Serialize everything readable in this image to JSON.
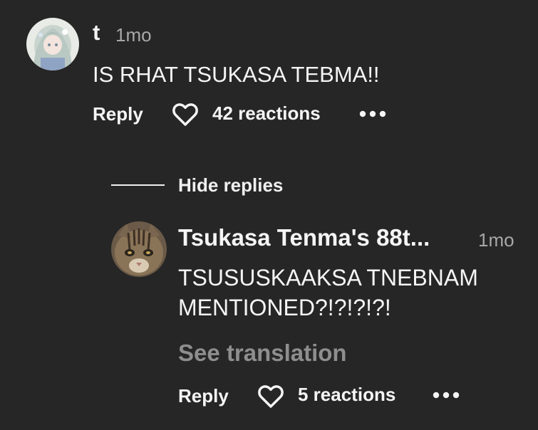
{
  "comment": {
    "username": "t",
    "time": "1mo",
    "text": "IS RHAT TSUKASA TEBMA!!",
    "reply_label": "Reply",
    "reactions_label": "42 reactions",
    "avatar_icon": "anime-character-avatar",
    "more_icon": "more-horizontal-icon",
    "heart_icon": "heart-outline-icon"
  },
  "replies": {
    "toggle_label": "Hide replies",
    "items": [
      {
        "username": "Tsukasa Tenma's 88t...",
        "time": "1mo",
        "text": "TSUSUSKAAKSA TNEBNAM MENTIONED?!?!?!?!",
        "translation_label": "See translation",
        "reply_label": "Reply",
        "reactions_label": "5 reactions",
        "avatar_icon": "cat-photo-avatar",
        "more_icon": "more-horizontal-icon",
        "heart_icon": "heart-outline-icon"
      }
    ]
  },
  "colors": {
    "background": "#262626",
    "text_primary": "#f5f5f5",
    "text_secondary": "#a8a8a8",
    "translation": "#8e8e8e"
  }
}
